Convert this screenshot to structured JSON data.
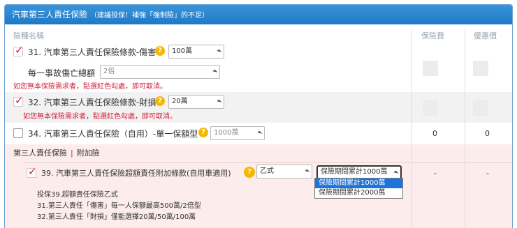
{
  "header": {
    "title": "汽車第三人責任保險",
    "subtitle": "（建議投保！補強「強制險」的不足）"
  },
  "columns": {
    "name": "險種名稱",
    "premium": "保險費",
    "discount": "優惠價"
  },
  "rows": [
    {
      "label": "31. 汽車第三人責任保險條款-傷害",
      "checked": true,
      "select": "100萬",
      "sub_label": "每一事故傷亡總額",
      "sub_select": "2倍",
      "note": "如您無本保險需求者，點選紅色勾處，即可取消。"
    },
    {
      "label": "32. 汽車第三人責任保險條款-財損",
      "checked": true,
      "select": "20萬",
      "note": "如您無本保險需求者，點選紅色勾處，即可取消。"
    },
    {
      "label": "34. 汽車第三人責任保險（自用）-單一保額型",
      "checked": false,
      "select": "1000萬",
      "premium": "0",
      "discount": "0"
    }
  ],
  "addon": {
    "section_title": "第三人責任保險",
    "section_sub": "附加險",
    "label": "39. 汽車第三人責任保險超額責任附加條款(自用車適用)",
    "checked": true,
    "type_select": "乙式",
    "limit_select": "保險期間累計1000萬",
    "options": [
      "保險期間累計1000萬",
      "保險期間累計2000萬"
    ],
    "premium": "-",
    "discount": "-",
    "info": [
      "投保39.超額責任保險乙式",
      "31.第三人責任「傷害」每一人保額最高500萬/2倍型",
      "32.第三人責任「財損」僅能選擇20萬/50萬/100萬"
    ]
  },
  "colors": {
    "title_bar": "#1f79c6",
    "accent_red": "#d0213a",
    "help_icon": "#f5b800",
    "addon_bg": "#fdecec",
    "dropdown_selected": "#1e73d8"
  }
}
